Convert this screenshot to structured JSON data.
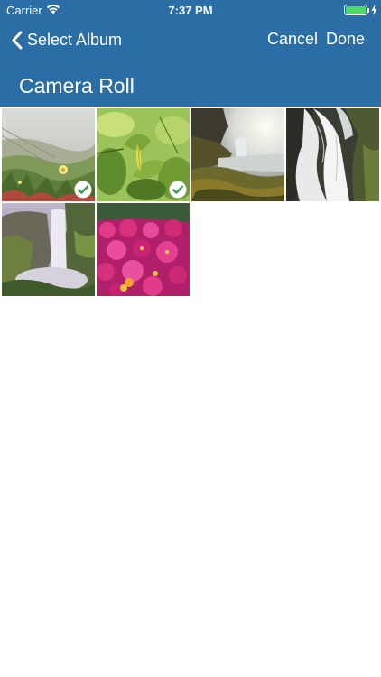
{
  "status_bar": {
    "carrier": "Carrier",
    "time": "7:37 PM",
    "battery_level": 1.0
  },
  "nav": {
    "back_label": "Select Album",
    "cancel_label": "Cancel",
    "done_label": "Done",
    "title": "Camera Roll"
  },
  "colors": {
    "header": "#2a6ea5",
    "header_text": "#ffffff",
    "battery_fill": "#4cd964",
    "check_fill": "#ffffff",
    "check_mark": "#3a9a56"
  },
  "photos": [
    {
      "subject": "coastal-ice-plants",
      "selected": true
    },
    {
      "subject": "green-leaves",
      "selected": true
    },
    {
      "subject": "waterfall-sunlight",
      "selected": false
    },
    {
      "subject": "waterfall-closeup",
      "selected": false
    },
    {
      "subject": "misty-waterfall-cliff",
      "selected": false
    },
    {
      "subject": "pink-flowers",
      "selected": false
    }
  ]
}
